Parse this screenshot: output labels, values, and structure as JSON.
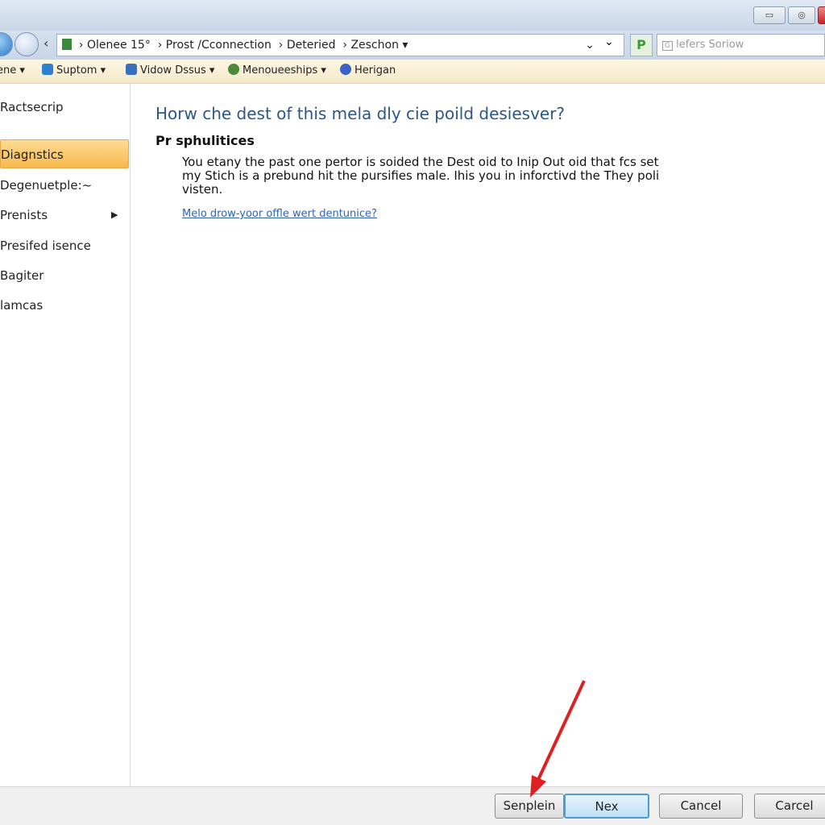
{
  "window": {
    "minimize": "▭",
    "restore": "◎",
    "close": "✕"
  },
  "address": {
    "path": [
      "Olenee 15°",
      "Prost /Cconnection",
      "Deteried",
      "Zeschon"
    ],
    "search_placeholder": "lefers Soriow"
  },
  "toolbar": {
    "items": [
      {
        "label": "ene ▾",
        "icon": "menu-icon"
      },
      {
        "label": "Suptom ▾",
        "icon": "support-icon",
        "color": "#2f7fd0"
      },
      {
        "label": "Vidow Dssus ▾",
        "icon": "window-icon",
        "color": "#3a6fc0"
      },
      {
        "label": "Menoueeships ▾",
        "icon": "globe-icon",
        "color": "#4a8a3a"
      },
      {
        "label": "Herigan",
        "icon": "help-icon",
        "color": "#3d62c4"
      }
    ]
  },
  "sidebar": {
    "header": "Ractsecrip",
    "items": [
      {
        "label": "Diagnstics",
        "active": true
      },
      {
        "label": "Degenuetple:~"
      },
      {
        "label": "Prenists",
        "submenu": true
      },
      {
        "label": "Presifed isence"
      },
      {
        "label": "Bagiter"
      },
      {
        "label": "lamcas"
      }
    ]
  },
  "main": {
    "title": "Horw che dest of this mela dly cie poild desiesver?",
    "subtitle": "Pr sphulitices",
    "body": "You etany the past one pertor is soided the Dest oid to Inip Out oid that fcs set my Stich is a prebund hit the pursifies male. Ihis you in inforctivd the They poli visten.",
    "link": "Melo drow-yoor offle wert dentunice?"
  },
  "buttons": {
    "b1": "Senplein",
    "b2": "Nex",
    "b3": "Cancel",
    "b4": "Carcel"
  },
  "annotation": {
    "arrow_color": "#e02020"
  }
}
